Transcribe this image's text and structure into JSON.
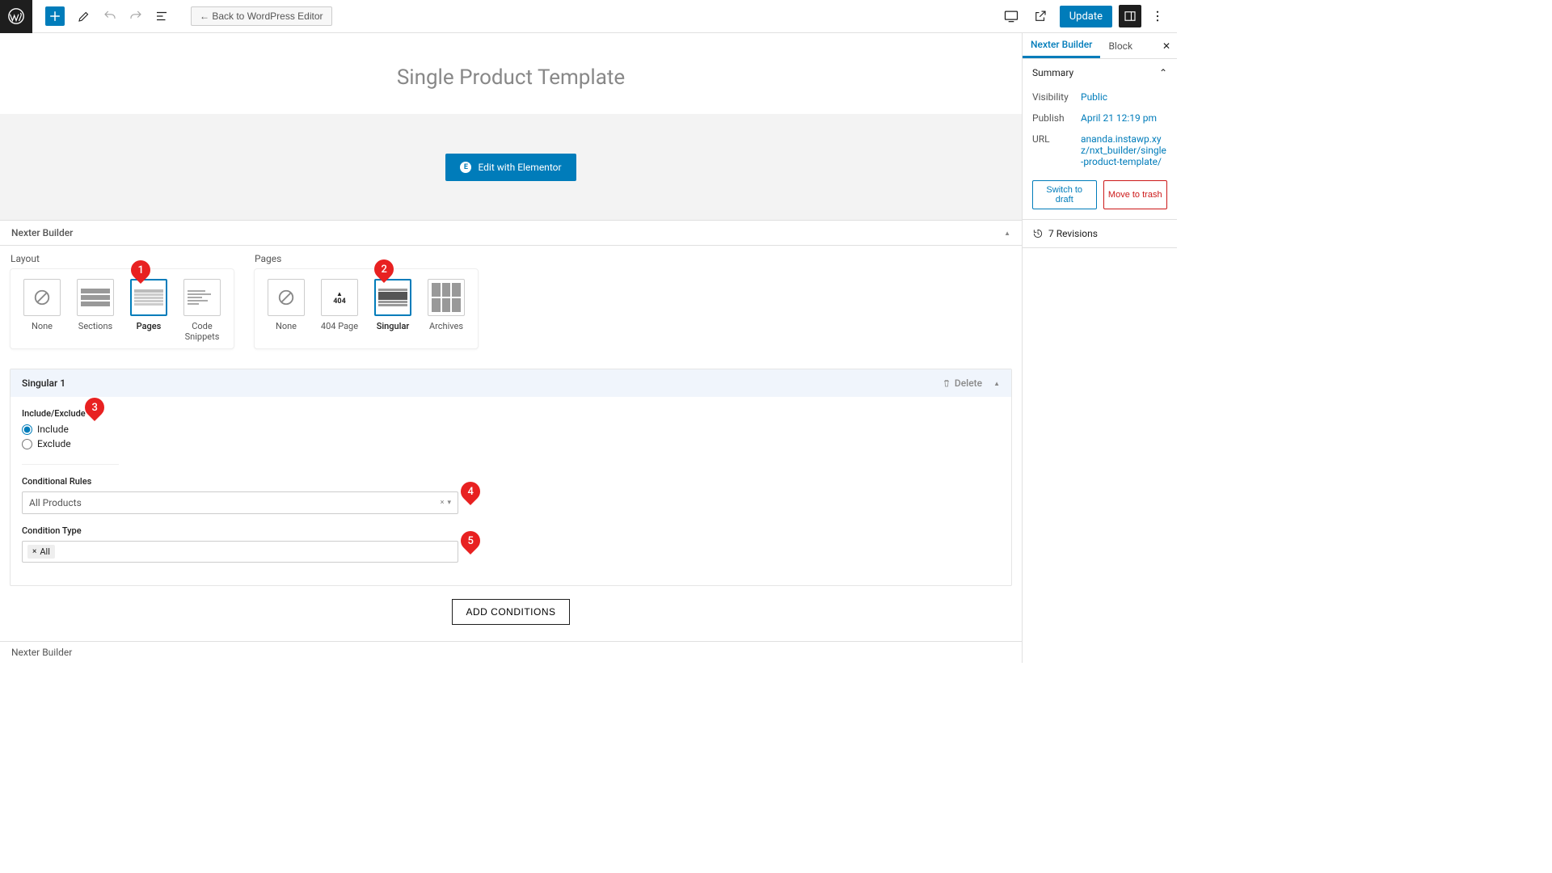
{
  "topbar": {
    "back_label": "← Back to WordPress Editor",
    "update_label": "Update"
  },
  "page": {
    "title": "Single Product Template",
    "elementor_btn": "Edit with Elementor"
  },
  "sidebar": {
    "tabs": {
      "nexter": "Nexter Builder",
      "block": "Block"
    },
    "summary_label": "Summary",
    "visibility_label": "Visibility",
    "visibility_value": "Public",
    "publish_label": "Publish",
    "publish_value": "April 21 12:19 pm",
    "url_label": "URL",
    "url_value": "ananda.instawp.xyz/nxt_builder/single-product-template/",
    "draft_btn": "Switch to draft",
    "trash_btn": "Move to trash",
    "revisions": "7 Revisions"
  },
  "nexter": {
    "panel_title": "Nexter Builder",
    "layout_label": "Layout",
    "pages_label": "Pages",
    "layout_options": [
      "None",
      "Sections",
      "Pages",
      "Code Snippets"
    ],
    "pages_options": [
      "None",
      "404 Page",
      "Singular",
      "Archives"
    ],
    "singular_title": "Singular 1",
    "delete_label": "Delete",
    "inc_exc_label": "Include/Exclude",
    "include_label": "Include",
    "exclude_label": "Exclude",
    "cond_rules_label": "Conditional Rules",
    "cond_rules_value": "All Products",
    "cond_type_label": "Condition Type",
    "cond_type_tag": "All",
    "add_conditions": "ADD CONDITIONS",
    "bottom_label": "Nexter Builder"
  },
  "badges": {
    "b1": "1",
    "b2": "2",
    "b3": "3",
    "b4": "4",
    "b5": "5"
  }
}
